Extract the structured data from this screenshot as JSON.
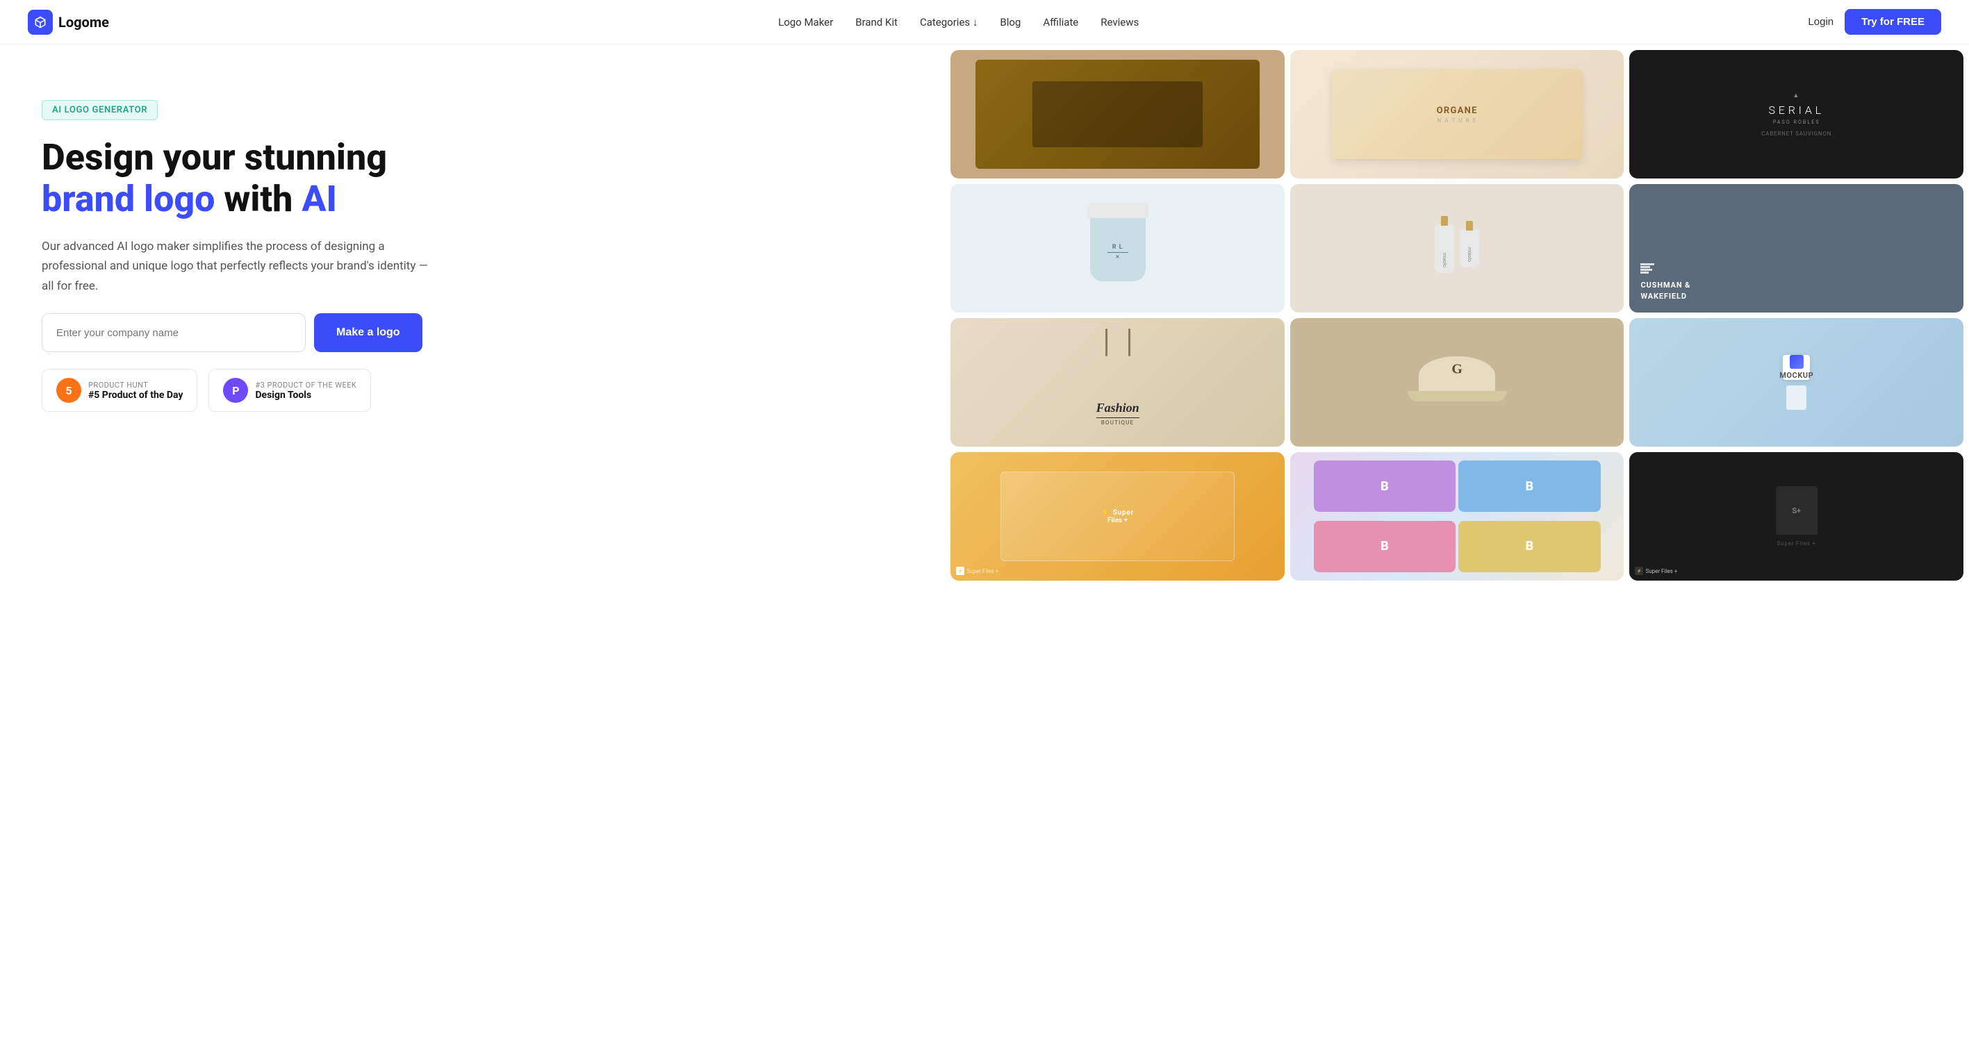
{
  "nav": {
    "logo_text": "Logome",
    "links": [
      {
        "label": "Logo Maker",
        "id": "logo-maker"
      },
      {
        "label": "Brand Kit",
        "id": "brand-kit"
      },
      {
        "label": "Categories ↓",
        "id": "categories"
      },
      {
        "label": "Blog",
        "id": "blog"
      },
      {
        "label": "Affiliate",
        "id": "affiliate"
      },
      {
        "label": "Reviews",
        "id": "reviews"
      }
    ],
    "login_label": "Login",
    "try_label": "Try for FREE"
  },
  "hero": {
    "badge_text": "AI LOGO GENERATOR",
    "headline_line1": "Design your stunning",
    "headline_line2_blue": "brand logo",
    "headline_line2_rest": " with ",
    "headline_ai": "AI",
    "subtext": "Our advanced AI logo maker simplifies the process of designing a professional and unique logo that perfectly reflects your brand's identity — all for free.",
    "input_placeholder": "Enter your company name",
    "cta_label": "Make a logo",
    "badge1_label": "PRODUCT HUNT",
    "badge1_value": "#5 Product of the Day",
    "badge2_label": "#3 PRODUCT OF THE WEEK",
    "badge2_value": "Design Tools"
  },
  "mosaic": {
    "cells": [
      {
        "id": "cell-box-top",
        "type": "box-brown"
      },
      {
        "id": "cell-organe",
        "type": "organe"
      },
      {
        "id": "cell-serial",
        "type": "serial"
      },
      {
        "id": "cell-coffee",
        "type": "coffee"
      },
      {
        "id": "cell-mixolo",
        "type": "mixolo"
      },
      {
        "id": "cell-cushman",
        "type": "cushman"
      },
      {
        "id": "cell-fashion",
        "type": "fashion"
      },
      {
        "id": "cell-cap",
        "type": "cap"
      },
      {
        "id": "cell-bizcard",
        "type": "bizcard"
      },
      {
        "id": "cell-boxorange",
        "type": "boxorange"
      },
      {
        "id": "cell-blogo",
        "type": "blogo"
      },
      {
        "id": "cell-totedark",
        "type": "totedark"
      }
    ]
  },
  "colors": {
    "primary": "#3b4cf8",
    "badge_bg": "#e6f9f5",
    "badge_color": "#1ca882"
  }
}
